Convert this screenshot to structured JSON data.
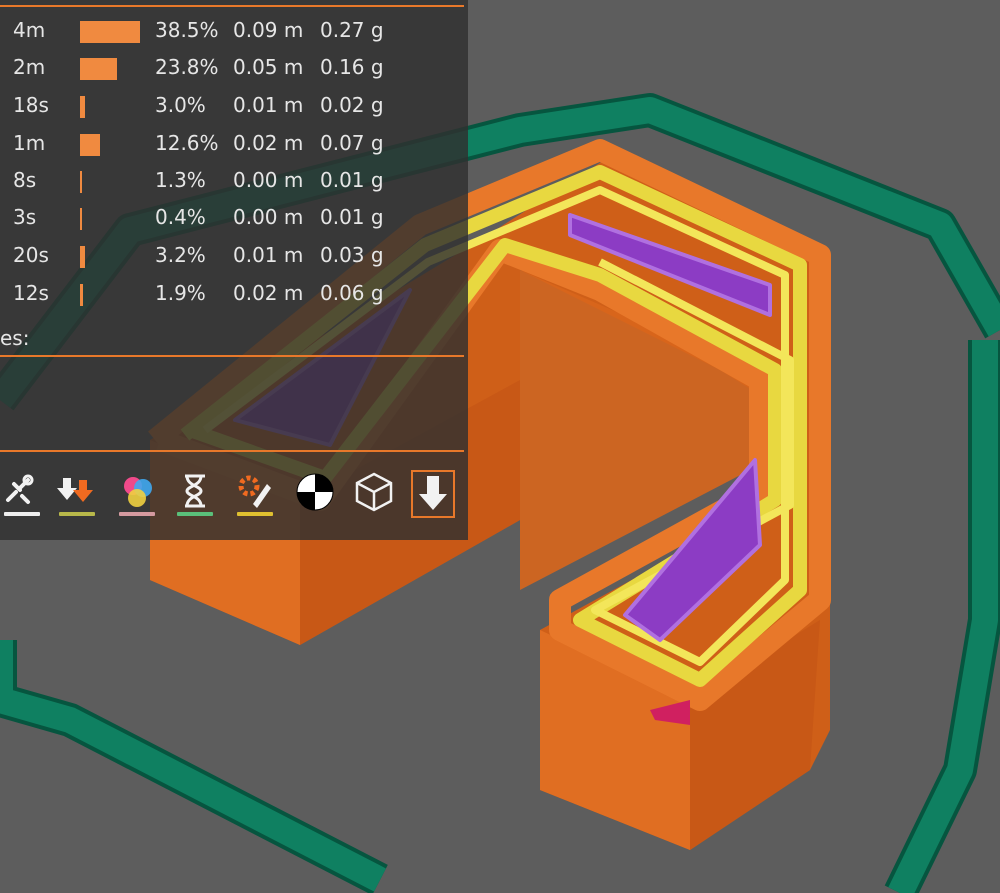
{
  "legend": {
    "rows": [
      {
        "time": "4m",
        "percent": "38.5%",
        "length": "0.09 m",
        "weight": "0.27 g",
        "share": 38.5
      },
      {
        "time": "2m",
        "percent": "23.8%",
        "length": "0.05 m",
        "weight": "0.16 g",
        "share": 23.8
      },
      {
        "time": "18s",
        "percent": "3.0%",
        "length": "0.01 m",
        "weight": "0.02 g",
        "share": 3.0
      },
      {
        "time": "1m",
        "percent": "12.6%",
        "length": "0.02 m",
        "weight": "0.07 g",
        "share": 12.6
      },
      {
        "time": "8s",
        "percent": "1.3%",
        "length": "0.00 m",
        "weight": "0.01 g",
        "share": 1.3
      },
      {
        "time": "3s",
        "percent": "0.4%",
        "length": "0.00 m",
        "weight": "0.01 g",
        "share": 0.4
      },
      {
        "time": "20s",
        "percent": "3.2%",
        "length": "0.01 m",
        "weight": "0.03 g",
        "share": 3.2
      },
      {
        "time": "12s",
        "percent": "1.9%",
        "length": "0.02 m",
        "weight": "0.06 g",
        "share": 1.9
      }
    ],
    "footer_label": "es:"
  },
  "toolbar": {
    "tools": [
      {
        "icon": "retractions-icon",
        "underline": "#eeeeee"
      },
      {
        "icon": "deretractions-icon",
        "underline": "#b8b84a"
      },
      {
        "icon": "color-changes-icon",
        "underline": "#d49aa0"
      },
      {
        "icon": "pause-hourglass-icon",
        "underline": "#5ac07a"
      },
      {
        "icon": "custom-gcode-icon",
        "underline": "#e0c030"
      },
      {
        "icon": "center-of-gravity-icon",
        "underline": ""
      },
      {
        "icon": "bounding-box-icon",
        "underline": ""
      },
      {
        "icon": "tool-marker-icon",
        "underline": ""
      }
    ]
  },
  "colors": {
    "accent": "#e8782a",
    "bar": "#f08a40",
    "skirt": "#0e7a5c",
    "perimeter_outer": "#e8782a",
    "perimeter_inner": "#e8d840",
    "solid_infill": "#9a48d0",
    "background": "#5d5d5d"
  }
}
